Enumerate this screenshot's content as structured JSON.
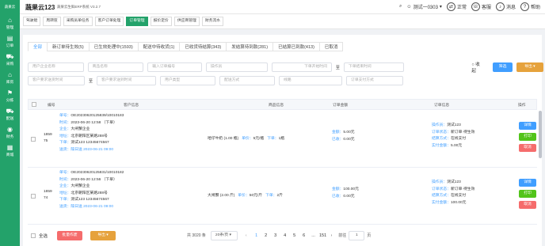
{
  "app": {
    "logo": "蔬果云",
    "name": "蔬果云123",
    "subtitle": "蔬果云生鲜ERP系统  V3.2.7"
  },
  "topbar": {
    "search": "",
    "user": "测试一0303",
    "status": "正常",
    "service": "客服",
    "messages": "消息",
    "help": "帮助"
  },
  "sidebar": [
    {
      "label": "管理",
      "icon": "⌂"
    },
    {
      "label": "订单",
      "icon": "▤"
    },
    {
      "label": "采购",
      "icon": "⛟"
    },
    {
      "label": "库房",
      "icon": "⌂"
    },
    {
      "label": "分拣",
      "icon": "⚑"
    },
    {
      "label": "配送",
      "icon": "⛟"
    },
    {
      "label": "财务",
      "icon": "◉"
    },
    {
      "label": "商城",
      "icon": "▦"
    }
  ],
  "page_tabs": [
    "驾驶舱",
    "周转筐",
    "采购员单任务",
    "客户订单处理",
    "订单管理",
    "报价定价",
    "供应商管理",
    "财务流水"
  ],
  "active_page_tab": "订单管理",
  "status_tabs": [
    "全部",
    "新订单待生效(5)",
    "已生效处理中(1593)",
    "配送中待收货(1)",
    "已收货待结算(343)",
    "发结算待到款(281)",
    "已结算已到款(413)",
    "已取消"
  ],
  "filters": {
    "row1": [
      "用户企业名称",
      "商品名称",
      "输入订单编号",
      "操作员",
      "下单开始时间",
      "下单结束时间"
    ],
    "row2": [
      "客户要求送货时间",
      "客户要求送到时间",
      "用户类型",
      "配送方式",
      "线路",
      "订单支付方式"
    ],
    "to": "至",
    "collapse": "收起",
    "search_btn": "筛选",
    "export_btn": "导出"
  },
  "table_headers": [
    "编号",
    "客户信息",
    "商品信息",
    "订单金额",
    "订单信息",
    "操作"
  ],
  "labels": {
    "order_no": "单号：",
    "time": "时间：",
    "company": "企业：",
    "address": "地址：",
    "buyer": "下单：",
    "deliver": "送货：",
    "goods_price": "单价：",
    "goods_qty": "下单：",
    "amount": "金额：",
    "paid": "已收：",
    "operator": "操作员：",
    "state": "订单状态：",
    "pay": "结算方式：",
    "actual": "实付金额："
  },
  "rows": [
    {
      "id": "1859 75",
      "order_no": "OE20230620125839/10010183",
      "time": "2023-06-20 12:58 （下单）",
      "company": "大闸蟹企业",
      "address": "北京朝阳区某路288号",
      "buyer": "测试123 12345674567",
      "deliver": "隔日送 2023-06-21 09:00",
      "goods_name": "哈仔牛奶 (1.00 瓶)",
      "goods_price": "5元/瓶",
      "goods_qty": "1瓶",
      "amount": "5.00元",
      "paid": "0.00元",
      "operator": "测试123",
      "state": "新订单·待生效",
      "pay": "在线支付",
      "actual": "5.00元",
      "ops": [
        "详情",
        "打印",
        "取消"
      ]
    },
    {
      "id": "1859 74",
      "order_no": "OE20230620125831/10010182",
      "time": "2023-06-20 12:56 （下单）",
      "company": "大闸蟹企业",
      "address": "北京朝阳区某路288号",
      "buyer": "测试123 12345674567",
      "deliver": "隔日送 2023-06-21 09:00",
      "goods_name": "大闸蟹 (2.00 斤)",
      "goods_price": "50元/斤",
      "goods_qty": "2斤",
      "amount": "100.00元",
      "paid": "0.00元",
      "operator": "测试123",
      "state": "新订单·待生效",
      "pay": "在线支付",
      "actual": "100.00元",
      "ops": [
        "详情",
        "打印",
        "取消"
      ]
    }
  ],
  "footer": {
    "select_all": "全选",
    "batch_btn": "批量作废",
    "export_btn": "导出",
    "total": "共 3020 条",
    "page_size": "20条/页",
    "pages": [
      "1",
      "2",
      "3",
      "4",
      "5",
      "6",
      "...",
      "151"
    ],
    "goto": "前往",
    "goto_page": "1",
    "page_unit": "页"
  },
  "colors": {
    "brand": "#23a26a",
    "primary": "#409eff",
    "success": "#52c41a",
    "danger": "#f56c6c",
    "warning": "#e6a23c"
  }
}
